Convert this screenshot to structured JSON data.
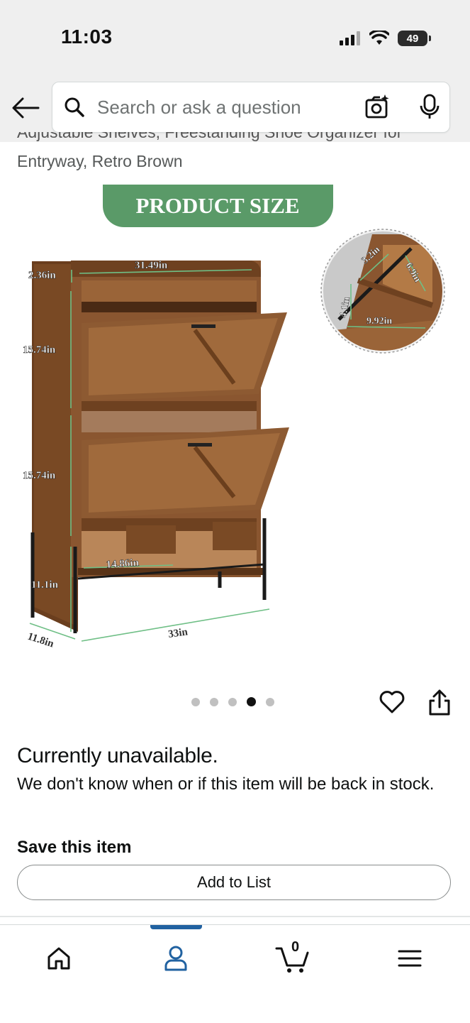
{
  "status_bar": {
    "time": "11:03",
    "battery": "49"
  },
  "search": {
    "placeholder": "Search or ask a question"
  },
  "product": {
    "title_partial": "Adjustable Shelves, Freestanding Shoe Organizer for",
    "title_line2": "Entryway, Retro Brown"
  },
  "image": {
    "banner": "PRODUCT SIZE",
    "dimensions": {
      "top_width": "31.49in",
      "top_height": "2.36in",
      "upper_section": "15.74in",
      "lower_section": "15.74in",
      "bottom_gap": "11.1in",
      "depth": "11.8in",
      "total_width": "33in",
      "shelf_width": "14.86in",
      "detail_a": "3.2in",
      "detail_b": "6.9in",
      "detail_c": "4.1in",
      "detail_d": "9.92in"
    },
    "carousel": {
      "count": 5,
      "active_index": 3
    }
  },
  "availability": {
    "title": "Currently unavailable.",
    "description": "We don't know when or if this item will be back in stock."
  },
  "save": {
    "title": "Save this item",
    "button": "Add to List"
  },
  "nav": {
    "cart_count": "0",
    "items": [
      "home-icon",
      "account-icon",
      "cart-icon",
      "menu-icon"
    ]
  },
  "colors": {
    "banner_green": "#5a9a68",
    "wood": "#7a4a25",
    "nav_accent": "#2162a1"
  }
}
